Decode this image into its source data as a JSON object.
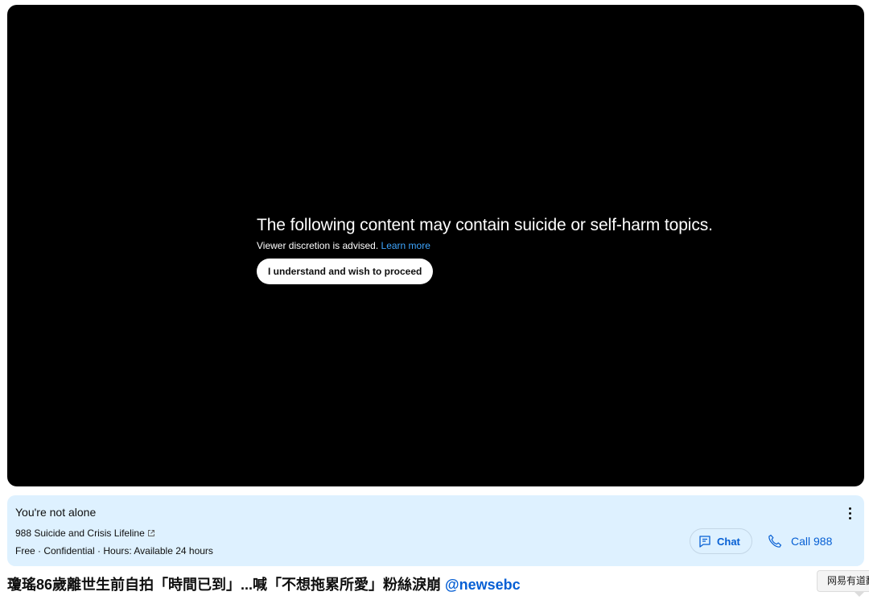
{
  "player": {
    "warning_title": "The following content may contain suicide or self-harm topics.",
    "warning_sub": "Viewer discretion is advised.",
    "learn_more": "Learn more",
    "proceed_label": "I understand and wish to proceed",
    "background_color": "#000000"
  },
  "crisis_panel": {
    "title": "You're not alone",
    "lifeline": "988 Suicide and Crisis Lifeline",
    "meta": "Free · Confidential · Hours: Available 24 hours",
    "chat_label": "Chat",
    "call_label": "Call 988",
    "background_color": "#def1ff",
    "accent_color": "#065fd4",
    "icons": [
      "external-link-icon",
      "more-vert-icon",
      "chat-icon",
      "phone-icon"
    ]
  },
  "video": {
    "title": "瓊瑤86歲離世生前自拍「時間已到」...喊「不想拖累所愛」粉絲淚崩",
    "channel_handle": "@newsebc"
  },
  "tooltip": {
    "text": "网易有道翻译"
  }
}
